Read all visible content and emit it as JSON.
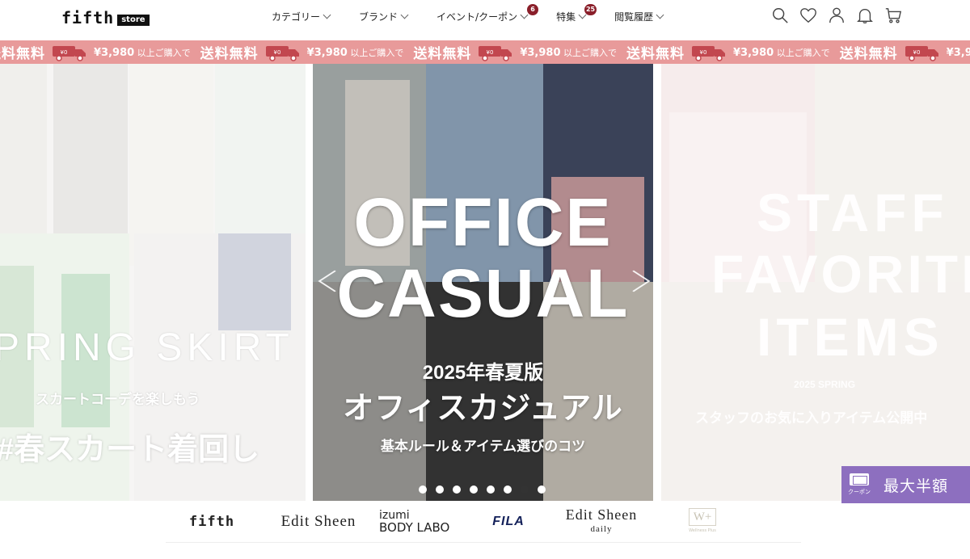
{
  "header": {
    "logo_main": "fifth",
    "logo_badge": "store",
    "nav": [
      {
        "label": "カテゴリー"
      },
      {
        "label": "ブランド"
      },
      {
        "label": "イベント/クーポン",
        "badge": "6"
      },
      {
        "label": "特集",
        "badge": "25"
      },
      {
        "label": "閲覧履歴"
      }
    ],
    "icons": [
      "search-icon",
      "heart-icon",
      "user-icon",
      "bell-icon",
      "cart-icon"
    ]
  },
  "promo_strip": {
    "free_text": "送料無料",
    "condition_price": "¥3,980",
    "condition_text": "以上ご購入で",
    "car_label": "¥0",
    "color": "#e89a9a"
  },
  "hero": {
    "left": {
      "headline": "PRING SKIRT",
      "subline": "スカートコーデを楽しもう",
      "tagline": "#春スカート着回し"
    },
    "center": {
      "title_line1": "OFFICE",
      "title_line2": "CASUAL",
      "edition": "2025年春夏版",
      "title_jp": "オフィスカジュアル",
      "subtitle": "基本ルール＆アイテム選びのコツ"
    },
    "right": {
      "title_line1": "STAFF",
      "title_line2": "FAVORITE",
      "title_line3": "ITEMS",
      "season": "2025 SPRING",
      "subtitle": "スタッフのお気に入りアイテム公開中"
    },
    "dots_count": 8,
    "active_dot": 7
  },
  "coupon": {
    "icon_label": "クーポン",
    "text": "最大半額",
    "color": "#8d6fbf"
  },
  "brands": [
    {
      "name": "fifth"
    },
    {
      "name": "Edit Sheen"
    },
    {
      "name_line1": "izumi",
      "name_line2": "BODY LABO"
    },
    {
      "name": "FILA"
    },
    {
      "name_line1": "Edit Sheen",
      "name_line2": "daily"
    },
    {
      "name_line1": "W+",
      "name_line2": "Wellness Plus"
    }
  ]
}
